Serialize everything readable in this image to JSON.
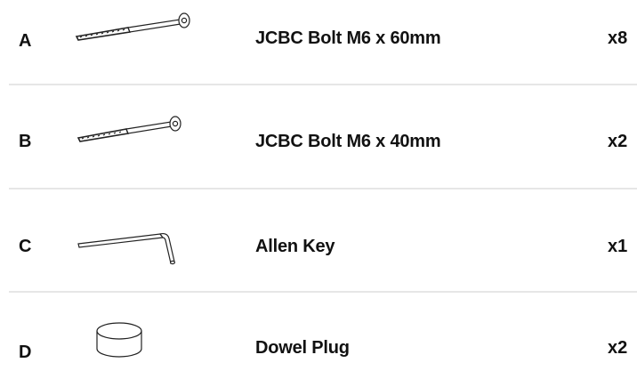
{
  "parts": [
    {
      "letter": "A",
      "name": "JCBC Bolt M6 x 60mm",
      "qty": "x8",
      "icon": "bolt-long-icon"
    },
    {
      "letter": "B",
      "name": "JCBC Bolt M6 x 40mm",
      "qty": "x2",
      "icon": "bolt-short-icon"
    },
    {
      "letter": "C",
      "name": "Allen Key",
      "qty": "x1",
      "icon": "allen-key-icon"
    },
    {
      "letter": "D",
      "name": "Dowel Plug",
      "qty": "x2",
      "icon": "dowel-plug-icon"
    }
  ]
}
